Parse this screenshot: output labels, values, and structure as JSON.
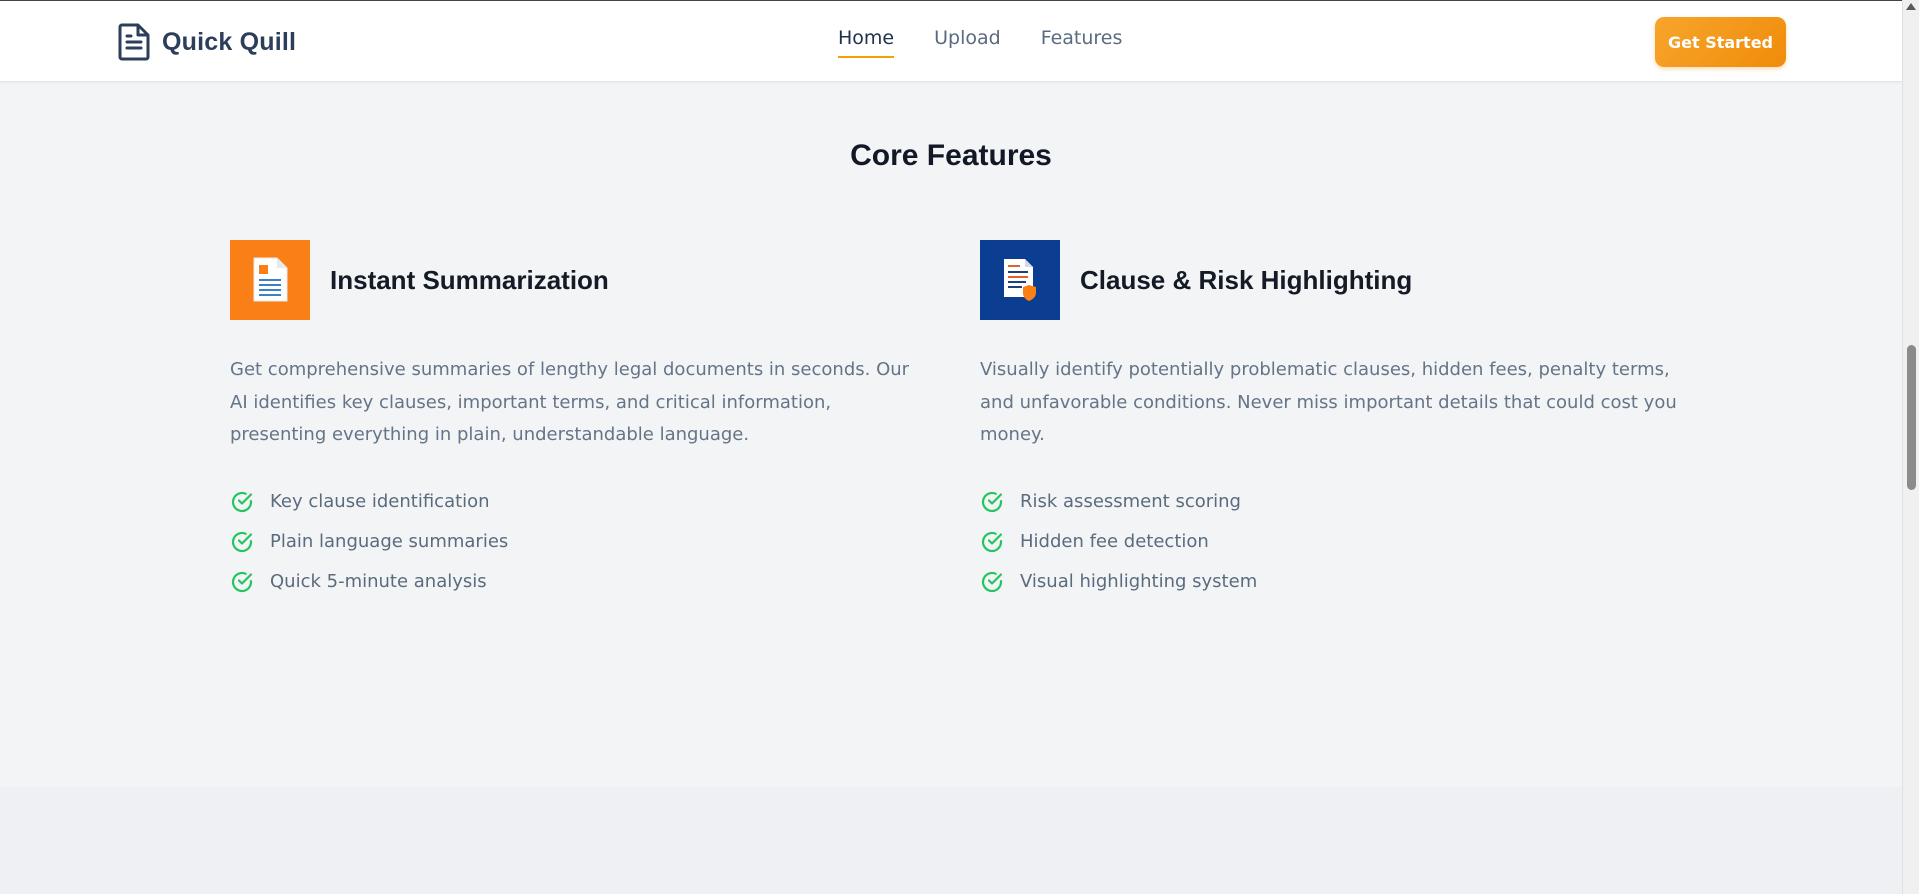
{
  "nav": {
    "brand": "Quick Quill",
    "links": [
      {
        "label": "Home",
        "active": true
      },
      {
        "label": "Upload",
        "active": false
      },
      {
        "label": "Features",
        "active": false
      }
    ],
    "cta": "Get Started"
  },
  "section": {
    "title": "Core Features"
  },
  "features": [
    {
      "icon": "document-icon",
      "accent": "#fb7f17",
      "title": "Instant Summarization",
      "description": "Get comprehensive summaries of lengthy legal documents in seconds. Our AI identifies key clauses, important terms, and critical information, presenting everything in plain, understandable language.",
      "items": [
        "Key clause identification",
        "Plain language summaries",
        "Quick 5-minute analysis"
      ]
    },
    {
      "icon": "document-shield-icon",
      "accent": "#0b3d91",
      "title": "Clause & Risk Highlighting",
      "description": "Visually identify potentially problematic clauses, hidden fees, penalty terms, and unfavorable conditions. Never miss important details that could cost you money.",
      "items": [
        "Risk assessment scoring",
        "Hidden fee detection",
        "Visual highlighting system"
      ]
    }
  ],
  "colors": {
    "primary_text": "#2d3e5a",
    "accent_orange": "#f59e0b",
    "check_green": "#22c55e",
    "background": "#f3f4f6"
  }
}
